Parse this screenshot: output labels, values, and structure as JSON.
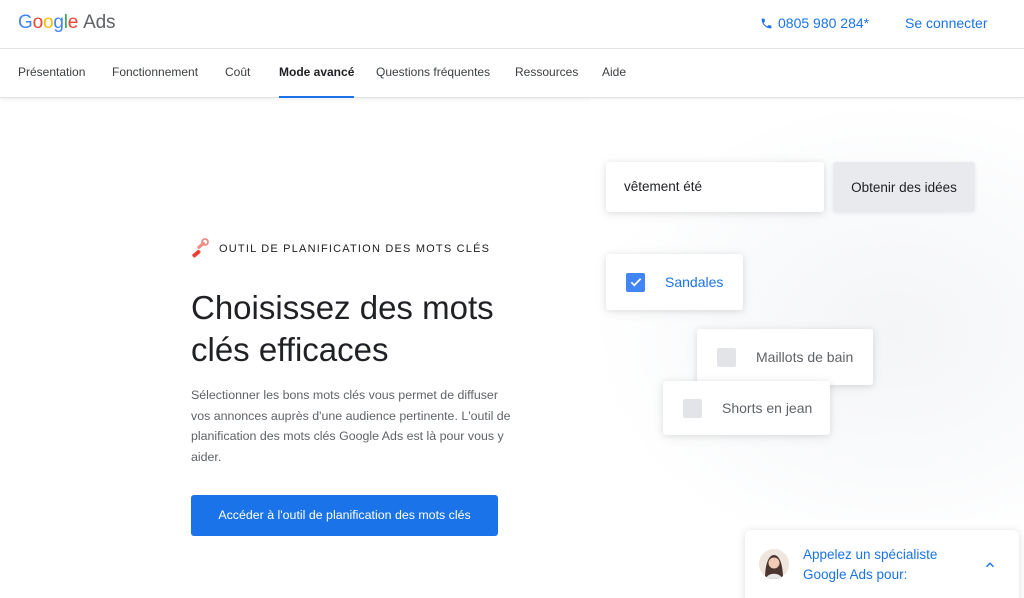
{
  "header": {
    "logo_google": [
      "G",
      "o",
      "o",
      "g",
      "l",
      "e"
    ],
    "logo_ads": "Ads",
    "phone": "0805 980 284*",
    "signin": "Se connecter"
  },
  "nav": {
    "items": [
      {
        "label": "Présentation"
      },
      {
        "label": "Fonctionnement"
      },
      {
        "label": "Coût"
      },
      {
        "label": "Mode avancé",
        "active": true
      },
      {
        "label": "Questions fréquentes"
      },
      {
        "label": "Ressources"
      },
      {
        "label": "Aide"
      }
    ]
  },
  "hero": {
    "eyebrow": "OUTIL DE PLANIFICATION DES MOTS CLÉS",
    "headline_line1": "Choisissez des mots",
    "headline_line2": "clés efficaces",
    "description": "Sélectionner les bons mots clés vous permet de diffuser vos annonces auprès d'une audience pertinente. L'outil de planification des mots clés Google Ads est là pour vous y aider.",
    "cta": "Accéder à l'outil de planification des mots clés"
  },
  "tool": {
    "input_value": "vêtement été",
    "button": "Obtenir des idées",
    "keywords": [
      {
        "label": "Sandales",
        "checked": true
      },
      {
        "label": "Maillots de bain",
        "checked": false
      },
      {
        "label": "Shorts en jean",
        "checked": false
      }
    ]
  },
  "chat": {
    "line1": "Appelez un spécialiste",
    "line2": "Google Ads pour:"
  },
  "colors": {
    "accent": "#1a73e8",
    "checkbox_checked": "#4285f4",
    "checkbox_unchecked": "#e2e4e8",
    "button_gray": "#e8eaed"
  },
  "icons": [
    "phone-icon",
    "wrench-icon",
    "checkmark-icon",
    "chevron-up-icon"
  ]
}
